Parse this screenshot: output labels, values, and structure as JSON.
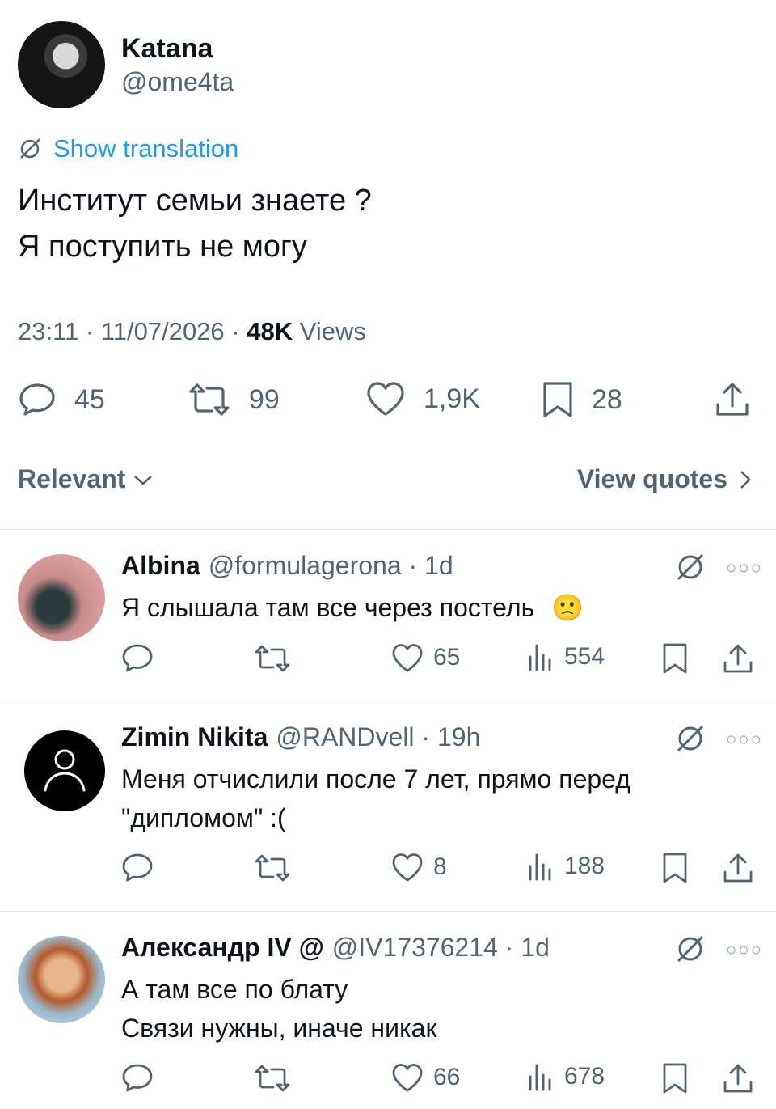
{
  "tweet": {
    "author_name": "Katana",
    "author_handle": "@ome4ta",
    "show_translation": "Show translation",
    "text_lines": [
      "Институт семьи знаете ?",
      "Я поступить не могу"
    ],
    "time": "23:11 · 11/07/2026 · ",
    "views_count": "48K",
    "views_label": " Views",
    "counts": {
      "replies": "45",
      "reposts": "99",
      "likes": "1,9K",
      "bookmarks": "28"
    }
  },
  "filters": {
    "sort_label": "Relevant",
    "view_quotes": "View quotes"
  },
  "replies": [
    {
      "name": "Albina",
      "handle": "@formulagerona",
      "time": " · 1d",
      "text": "Я слышала там все через постель",
      "emoji": "🙁",
      "likes": "65",
      "views": "554"
    },
    {
      "name": "Zimin Nikita",
      "handle": "@RANDvell",
      "time": " · 19h",
      "text": "Меня отчислили после 7 лет, прямо перед \"дипломом\" :(",
      "likes": "8",
      "views": "188"
    },
    {
      "name": "Александр IV @",
      "handle": "@IV17376214",
      "time": " · 1d",
      "text_line1": "А там все по блату",
      "text_line2": "Связи нужны, иначе никак",
      "likes": "66",
      "views": "678"
    }
  ],
  "colors": {
    "link": "#1d9bf0",
    "muted": "#536471",
    "text": "#0f1419"
  },
  "icons": [
    "grok-icon",
    "reply-icon",
    "repost-icon",
    "like-icon",
    "bookmark-icon",
    "share-icon",
    "views-icon",
    "more-icon",
    "chevron-down-icon",
    "chevron-right-icon"
  ]
}
